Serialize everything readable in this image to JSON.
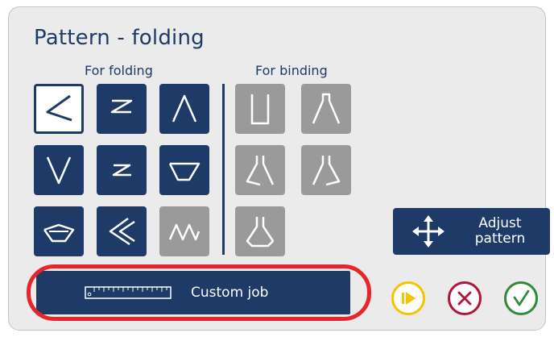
{
  "dialog": {
    "title": "Pattern - folding"
  },
  "groups": {
    "folding_label": "For folding",
    "binding_label": "For binding"
  },
  "folding_patterns": [
    {
      "icon": "fold-angle-left-icon",
      "selected": true
    },
    {
      "icon": "fold-z-icon",
      "selected": false
    },
    {
      "icon": "fold-peak-icon",
      "selected": false
    },
    {
      "icon": "fold-v-icon",
      "selected": false
    },
    {
      "icon": "fold-small-z-icon",
      "selected": false
    },
    {
      "icon": "fold-trapezoid-icon",
      "selected": false
    },
    {
      "icon": "fold-m-trapezoid-icon",
      "selected": false
    },
    {
      "icon": "fold-double-angle-icon",
      "selected": false
    },
    {
      "icon": "fold-zigzag-icon",
      "selected": false,
      "disabled": true
    }
  ],
  "binding_patterns": [
    {
      "icon": "bind-u-icon"
    },
    {
      "icon": "bind-a-icon"
    },
    {
      "icon": "bind-a-left-icon"
    },
    {
      "icon": "bind-a-right-icon"
    },
    {
      "icon": "bind-flask-icon"
    }
  ],
  "buttons": {
    "adjust_pattern_label": "Adjust pattern",
    "custom_job_label": "Custom job",
    "play_icon": "play-icon",
    "cancel_icon": "cancel-icon",
    "confirm_icon": "confirm-icon"
  },
  "colors": {
    "navy": "#1e3a66",
    "gray_tile": "#9a9a9a",
    "panel": "#ebebeb",
    "highlight": "#e8252b",
    "play": "#f5c400",
    "cancel": "#b0163a",
    "confirm": "#2e8b3a"
  }
}
